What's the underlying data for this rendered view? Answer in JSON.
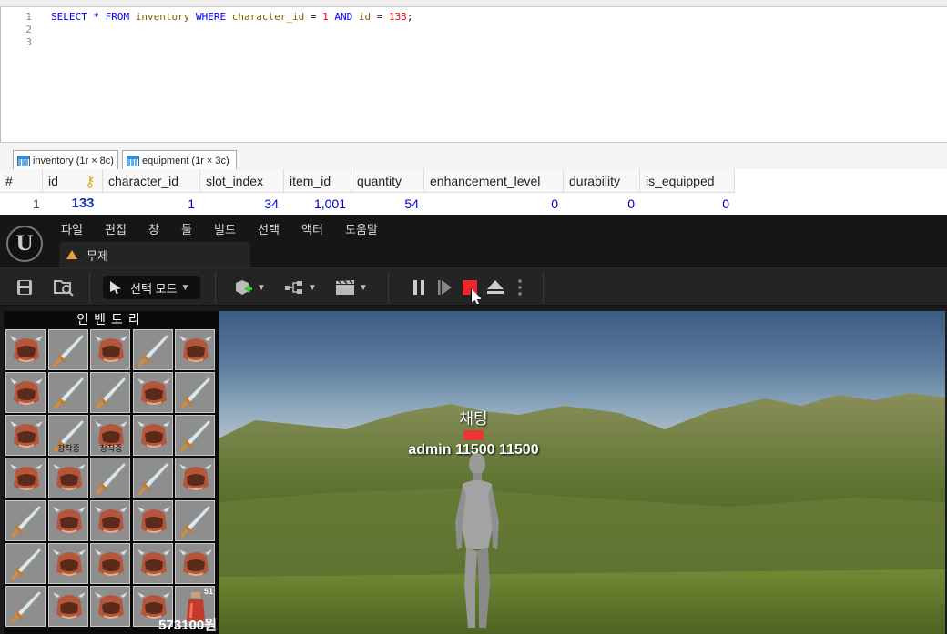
{
  "editor": {
    "lines": [
      {
        "num": "1",
        "tokens": [
          {
            "t": "SELECT",
            "c": "kw"
          },
          {
            "t": " ",
            "c": "op"
          },
          {
            "t": "*",
            "c": "kw"
          },
          {
            "t": " ",
            "c": "op"
          },
          {
            "t": "FROM",
            "c": "kw"
          },
          {
            "t": " ",
            "c": "op"
          },
          {
            "t": "inventory",
            "c": "id"
          },
          {
            "t": " ",
            "c": "op"
          },
          {
            "t": "WHERE",
            "c": "kw"
          },
          {
            "t": " ",
            "c": "op"
          },
          {
            "t": "character_id",
            "c": "id"
          },
          {
            "t": " = ",
            "c": "op"
          },
          {
            "t": "1",
            "c": "num"
          },
          {
            "t": " ",
            "c": "op"
          },
          {
            "t": "AND",
            "c": "kw"
          },
          {
            "t": " ",
            "c": "op"
          },
          {
            "t": "id",
            "c": "id"
          },
          {
            "t": " = ",
            "c": "op"
          },
          {
            "t": "133",
            "c": "num"
          },
          {
            "t": ";",
            "c": "op"
          }
        ]
      },
      {
        "num": "2",
        "tokens": []
      },
      {
        "num": "3",
        "tokens": []
      }
    ]
  },
  "result_tabs": [
    {
      "label": "inventory (1r × 8c)"
    },
    {
      "label": "equipment (1r × 3c)"
    }
  ],
  "result_grid": {
    "headers": [
      "#",
      "id",
      "character_id",
      "slot_index",
      "item_id",
      "quantity",
      "enhancement_level",
      "durability",
      "is_equipped"
    ],
    "row": [
      "1",
      "133",
      "1",
      "34",
      "1,001",
      "54",
      "0",
      "0",
      "0"
    ]
  },
  "ue": {
    "logo": "U",
    "menu": [
      "파일",
      "편집",
      "창",
      "툴",
      "빌드",
      "선택",
      "액터",
      "도움말"
    ],
    "tab_label": "무제",
    "mode_label": "선택 모드",
    "icons": [
      "save-icon",
      "content-browser-icon",
      "add-actor-icon",
      "blueprint-icon",
      "cinematics-icon",
      "pause-icon",
      "step-frame-icon",
      "stop-icon",
      "eject-icon",
      "more-options-icon"
    ]
  },
  "inventory": {
    "title": "인벤토리",
    "grid": [
      [
        "helmet",
        "sword",
        "helmet",
        "sword",
        "helmet"
      ],
      [
        "helmet",
        "sword",
        "sword",
        "helmet",
        "sword"
      ],
      [
        "helmet",
        "sword",
        "helmet",
        "helmet",
        "sword"
      ],
      [
        "helmet",
        "helmet",
        "sword",
        "sword",
        "helmet"
      ],
      [
        "sword",
        "helmet",
        "helmet",
        "helmet",
        "sword"
      ],
      [
        "sword",
        "helmet",
        "helmet",
        "helmet",
        "helmet"
      ],
      [
        "sword",
        "helmet",
        "helmet",
        "helmet",
        "potion"
      ]
    ],
    "equipped_slots": [
      {
        "row": 2,
        "col": 1,
        "label": "장착중"
      },
      {
        "row": 2,
        "col": 2,
        "label": "장착중"
      }
    ],
    "stack_count": {
      "row": 6,
      "col": 4,
      "label": "51"
    },
    "gold": "573100원"
  },
  "character": {
    "chat_label": "채팅",
    "name_line": "admin 11500 11500"
  }
}
